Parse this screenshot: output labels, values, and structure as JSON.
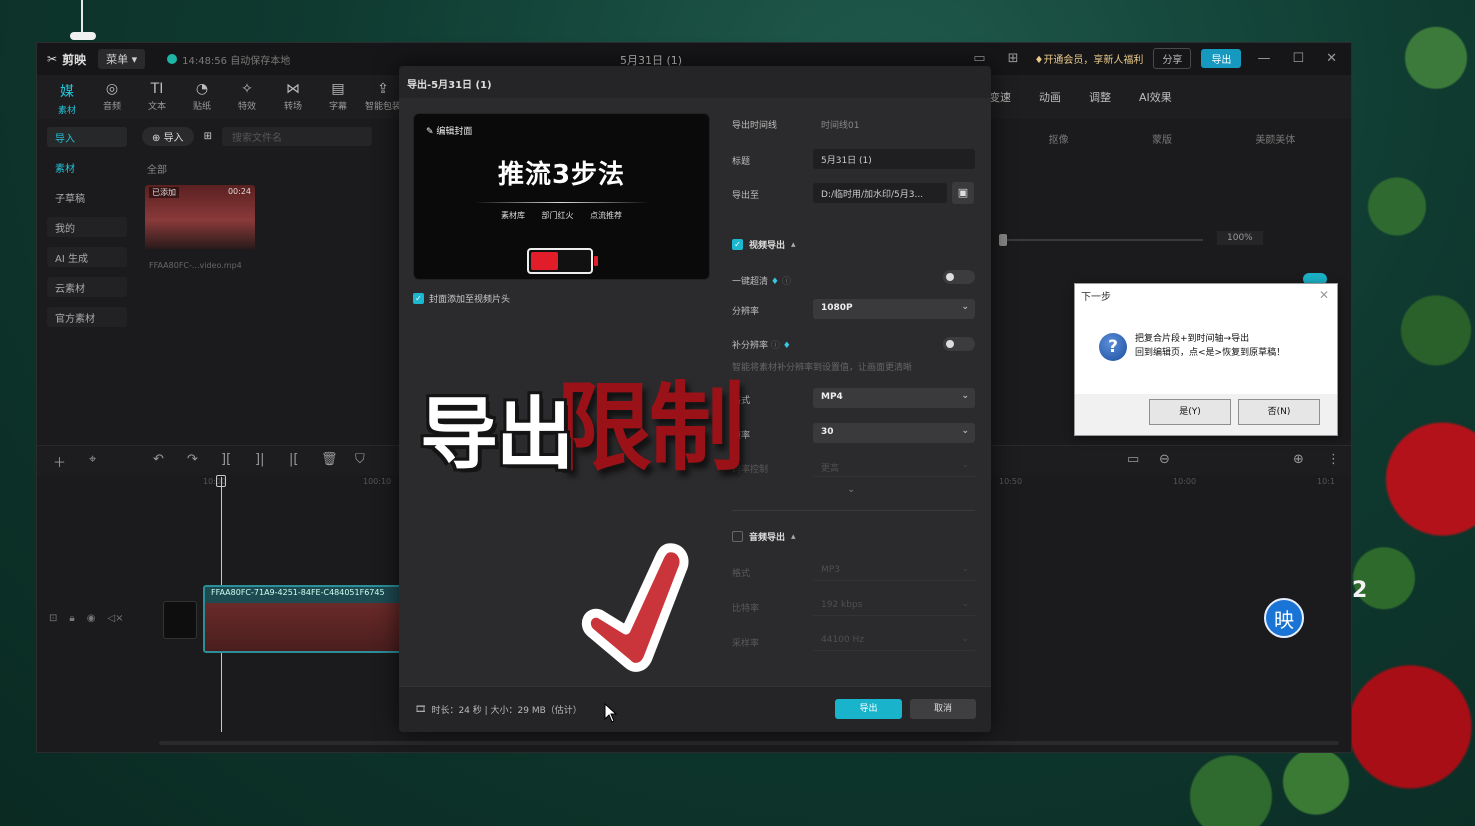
{
  "app": {
    "logo_text": "剪映",
    "menu_label": "菜单",
    "autosave_text": "14:48:56 自动保存本地",
    "window_title": "5月31日 (1)",
    "vip_text": "开通会员，享新人福利",
    "share_label": "分享",
    "export_label": "导出"
  },
  "toolbar": [
    {
      "icon": "媒",
      "label": "素材",
      "active": true
    },
    {
      "icon": "◎",
      "label": "音频"
    },
    {
      "icon": "TI",
      "label": "文本"
    },
    {
      "icon": "◔",
      "label": "贴纸"
    },
    {
      "icon": "✧",
      "label": "特效"
    },
    {
      "icon": "⋈",
      "label": "转场"
    },
    {
      "icon": "▤",
      "label": "字幕"
    },
    {
      "icon": "⇪",
      "label": "智能包装"
    }
  ],
  "right_tabs": [
    "变速",
    "动画",
    "调整",
    "AI效果"
  ],
  "right_subtabs": [
    "抠像",
    "蒙版",
    "美颜美体"
  ],
  "zoom_value": "100%",
  "sidebar": [
    {
      "label": "导入",
      "style": "active"
    },
    {
      "label": "素材",
      "style": "plain-active"
    },
    {
      "label": "子草稿",
      "style": "plain"
    },
    {
      "label": "我的",
      "style": "normal"
    },
    {
      "label": "AI 生成",
      "style": "normal"
    },
    {
      "label": "云素材",
      "style": "normal"
    },
    {
      "label": "官方素材",
      "style": "normal"
    }
  ],
  "media": {
    "import_label": "导入",
    "search_placeholder": "搜索文件名",
    "all_label": "全部",
    "thumb_tag": "已添加",
    "thumb_duration": "00:24",
    "thumb_name": "FFAA80FC-...video.mp4"
  },
  "timeline": {
    "ruler": [
      "10:00",
      "100:10",
      "10:50",
      "10:00",
      "10:1"
    ],
    "clip_name": "FFAA80FC-71A9-4251-84FE-C484051F6745"
  },
  "next_dialog": {
    "title": "下一步",
    "line1": "把复合片段+到时间轴→导出",
    "line2": "回到编辑页，点<是>恢复到原草稿！",
    "yes": "是(Y)",
    "no": "否(N)"
  },
  "ying_label": "映",
  "side_number": "2",
  "export_modal": {
    "title": "导出-5月31日 (1)",
    "cover": {
      "edit_label": "编辑封面",
      "big_text": "推流3步法",
      "tags": "素材库 部门红火 点流推荐",
      "battery_level": 0.47
    },
    "cover_checkbox": "封面添加至视频片头",
    "fields": {
      "timeline_label": "导出时间线",
      "timeline_value": "时间线01",
      "title_label": "标题",
      "title_value": "5月31日 (1)",
      "path_label": "导出至",
      "path_value": "D:/临时用/加水印/5月3...",
      "video_section": "视频导出",
      "hd_label": "一键超清",
      "res_label": "分辨率",
      "res_value": "1080P",
      "supplement_label": "补分辨率",
      "supplement_hint": "智能将素材补分辨率到设置值，让画面更清晰",
      "format_label": "格式",
      "format_value": "MP4",
      "fps_label": "帧率",
      "fps_value": "30",
      "bitrate_label": "码率控制",
      "bitrate_value": "更高",
      "audio_section": "音频导出",
      "audio_format_label": "格式",
      "audio_format_value": "MP3",
      "audio_bitrate_label": "比特率",
      "audio_bitrate_value": "192 kbps",
      "audio_sample_label": "采样率",
      "audio_sample_value": "44100 Hz"
    },
    "footer": {
      "info": "时长：24 秒 | 大小：29 MB（估计）",
      "export_btn": "导出",
      "cancel_btn": "取消"
    }
  },
  "overlay": {
    "white_text": "导出",
    "red_text": "限制"
  }
}
